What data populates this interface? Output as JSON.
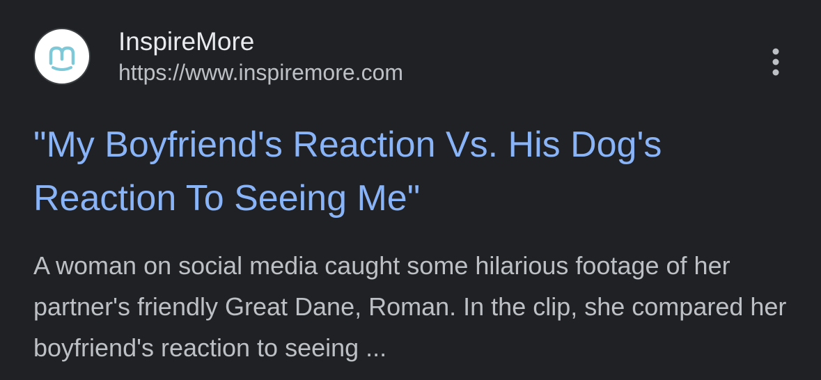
{
  "result": {
    "site_name": "InspireMore",
    "site_url": "https://www.inspiremore.com",
    "title": "\"My Boyfriend's Reaction Vs. His Dog's Reaction To Seeing Me\"",
    "snippet": "A woman on social media caught some hilarious footage of her partner's friendly Great Dane, Roman. In the clip, she compared her boyfriend's reaction to seeing ...",
    "favicon_icon": "inspiremore-smile-logo-icon",
    "more_icon": "vertical-dots-icon"
  },
  "colors": {
    "background": "#202124",
    "title_link": "#8ab4f8",
    "site_name": "#e8eaed",
    "secondary_text": "#bdc1c6",
    "logo_teal": "#7fc8d8"
  }
}
